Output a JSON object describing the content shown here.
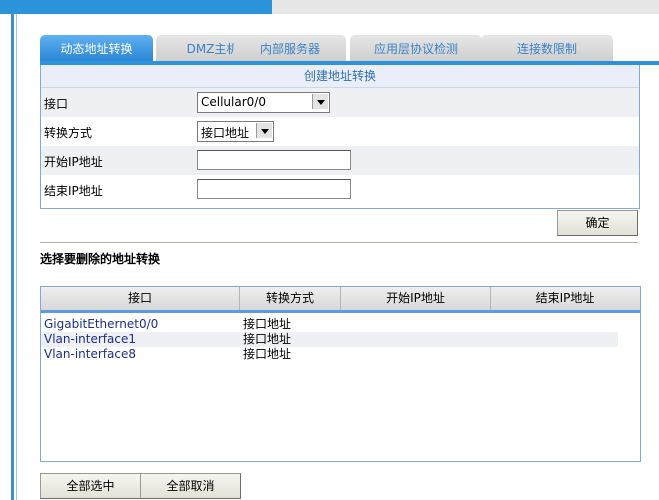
{
  "tabs": [
    {
      "label": "动态地址转换",
      "active": true
    },
    {
      "label": "DMZ主机",
      "active": false
    },
    {
      "label": "内部服务器",
      "active": false
    },
    {
      "label": "应用层协议检测",
      "active": false
    },
    {
      "label": "连接数限制",
      "active": false
    }
  ],
  "form": {
    "title": "创建地址转换",
    "interface_label": "接口",
    "interface_value": "Cellular0/0",
    "mode_label": "转换方式",
    "mode_value": "接口地址",
    "start_ip_label": "开始IP地址",
    "start_ip_value": "",
    "end_ip_label": "结束IP地址",
    "end_ip_value": "",
    "confirm_label": "确定"
  },
  "list": {
    "title": "选择要删除的地址转换",
    "columns": [
      "接口",
      "转换方式",
      "开始IP地址",
      "结束IP地址"
    ],
    "rows": [
      {
        "interface": "GigabitEthernet0/0",
        "mode": "接口地址",
        "start_ip": "",
        "end_ip": ""
      },
      {
        "interface": "Vlan-interface1",
        "mode": "接口地址",
        "start_ip": "",
        "end_ip": ""
      },
      {
        "interface": "Vlan-interface8",
        "mode": "接口地址",
        "start_ip": "",
        "end_ip": ""
      }
    ]
  },
  "buttons": {
    "select_all": "全部选中",
    "deselect_all": "全部取消"
  },
  "colors": {
    "accent": "#2b93d9",
    "panel_border": "#7fa9d6",
    "link": "#1e2f8a"
  }
}
